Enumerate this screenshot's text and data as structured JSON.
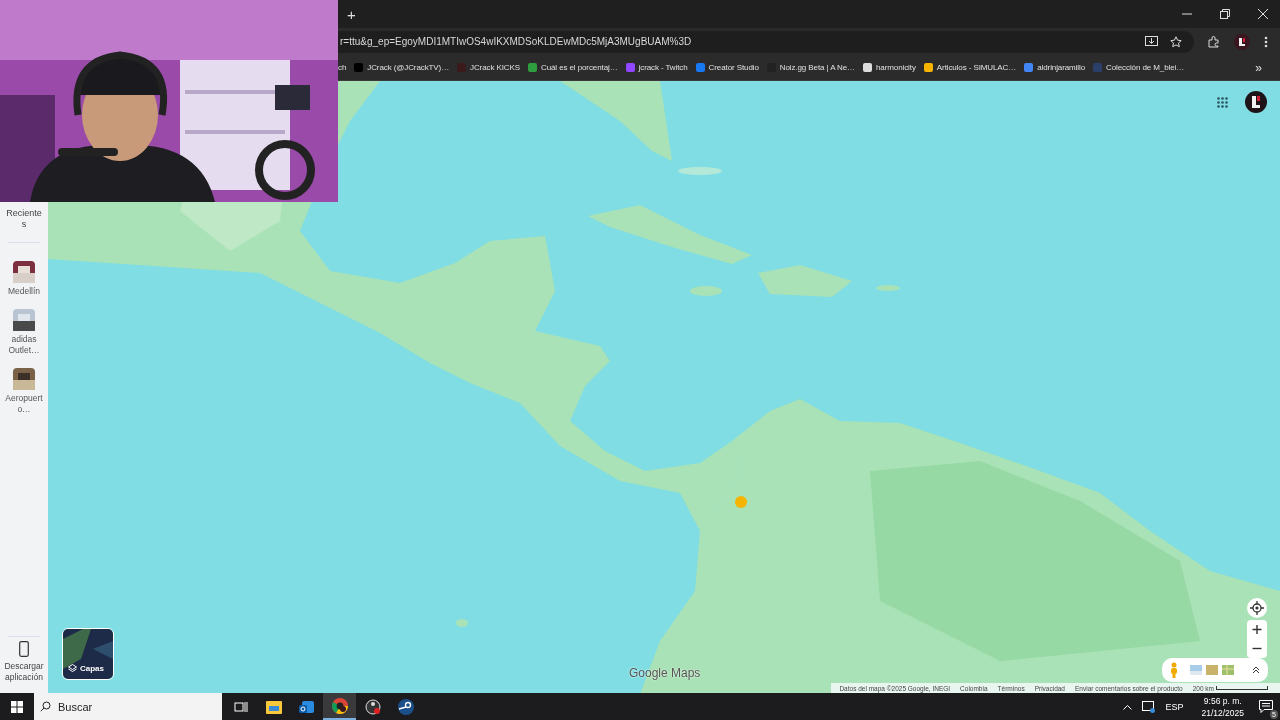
{
  "browser": {
    "new_tab": "+",
    "url": "r=ttu&g_ep=EgoyMDI1MTIwOS4wIKXMDSoKLDEwMDc5MjA3MUgBUAM%3D",
    "bookmarks": [
      {
        "kind": "none",
        "label": "ch"
      },
      {
        "kind": "x",
        "label": "JCrack (@JCrackTV)…"
      },
      {
        "kind": "jcrack",
        "label": "JCrack KICKS"
      },
      {
        "kind": "d",
        "label": "Cuál es el porcentaj…"
      },
      {
        "kind": "twitch",
        "label": "jcrack - Twitch"
      },
      {
        "kind": "facebook",
        "label": "Creator Studio"
      },
      {
        "kind": "noiz",
        "label": "Noiz.gg Beta | A Ne…"
      },
      {
        "kind": "harmonicity",
        "label": "harmonicity"
      },
      {
        "kind": "drive",
        "label": "Articulos - SIMULAC…"
      },
      {
        "kind": "doc",
        "label": "aldrinjaramillo"
      },
      {
        "kind": "shield",
        "label": "Colección de M_blei…"
      }
    ],
    "more": "»"
  },
  "sidebar": {
    "recent_title": "Recientes",
    "recents": [
      {
        "label": "Medellín"
      },
      {
        "label": "adidas Outlet…"
      },
      {
        "label": "Aeropuerto…"
      }
    ],
    "download": "Descargar aplicación"
  },
  "map": {
    "layers_label": "Capas",
    "logo": "Google Maps",
    "footer": [
      "Datos del mapa ©2025 Google, INEGI",
      "Colombia",
      "Términos",
      "Privacidad",
      "Enviar comentarios sobre el producto"
    ],
    "scale": "200 km"
  },
  "taskbar": {
    "search_placeholder": "Buscar",
    "apps": [
      {
        "kind": "taskview",
        "selected": false
      },
      {
        "kind": "explorer",
        "selected": false
      },
      {
        "kind": "outlook",
        "selected": false
      },
      {
        "kind": "chrome",
        "selected": true
      },
      {
        "kind": "obs",
        "selected": false
      },
      {
        "kind": "steam",
        "selected": false
      }
    ],
    "language": "ESP",
    "time": "9:56 p. m.",
    "date": "21/12/2025",
    "notifications": "5"
  }
}
